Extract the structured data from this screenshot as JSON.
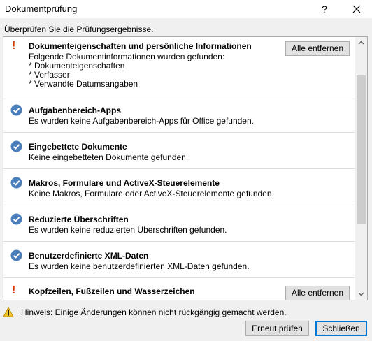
{
  "window": {
    "title": "Dokumentprüfung",
    "help_label": "?"
  },
  "subtitle": "Überprüfen Sie die Prüfungsergebnisse.",
  "results": [
    {
      "status": "warning",
      "icon": "warning-exclamation-icon",
      "title": "Dokumenteigenschaften und persönliche Informationen",
      "description": "Folgende Dokumentinformationen wurden gefunden:\n* Dokumenteigenschaften\n* Verfasser\n* Verwandte Datumsangaben",
      "action_label": "Alle entfernen"
    },
    {
      "status": "ok",
      "icon": "checkmark-circle-icon",
      "title": "Aufgabenbereich-Apps",
      "description": "Es wurden keine Aufgabenbereich-Apps für Office gefunden."
    },
    {
      "status": "ok",
      "icon": "checkmark-circle-icon",
      "title": "Eingebettete Dokumente",
      "description": "Keine eingebetteten Dokumente gefunden."
    },
    {
      "status": "ok",
      "icon": "checkmark-circle-icon",
      "title": "Makros, Formulare und ActiveX-Steuerelemente",
      "description": "Keine Makros, Formulare oder ActiveX-Steuerelemente gefunden."
    },
    {
      "status": "ok",
      "icon": "checkmark-circle-icon",
      "title": "Reduzierte Überschriften",
      "description": "Es wurden keine reduzierten Überschriften gefunden."
    },
    {
      "status": "ok",
      "icon": "checkmark-circle-icon",
      "title": "Benutzerdefinierte XML-Daten",
      "description": "Es wurden keine benutzerdefinierten XML-Daten gefunden."
    },
    {
      "status": "warning",
      "icon": "warning-exclamation-icon",
      "title": "Kopfzeilen, Fußzeilen und Wasserzeichen",
      "description": "",
      "action_label": "Alle entfernen"
    }
  ],
  "hint": "Hinweis: Einige Änderungen können nicht rückgängig gemacht werden.",
  "buttons": {
    "recheck": "Erneut prüfen",
    "close": "Schließen"
  },
  "colors": {
    "check": "#4a7ebb",
    "warning": "#d83b01",
    "accent": "#0078d7"
  }
}
